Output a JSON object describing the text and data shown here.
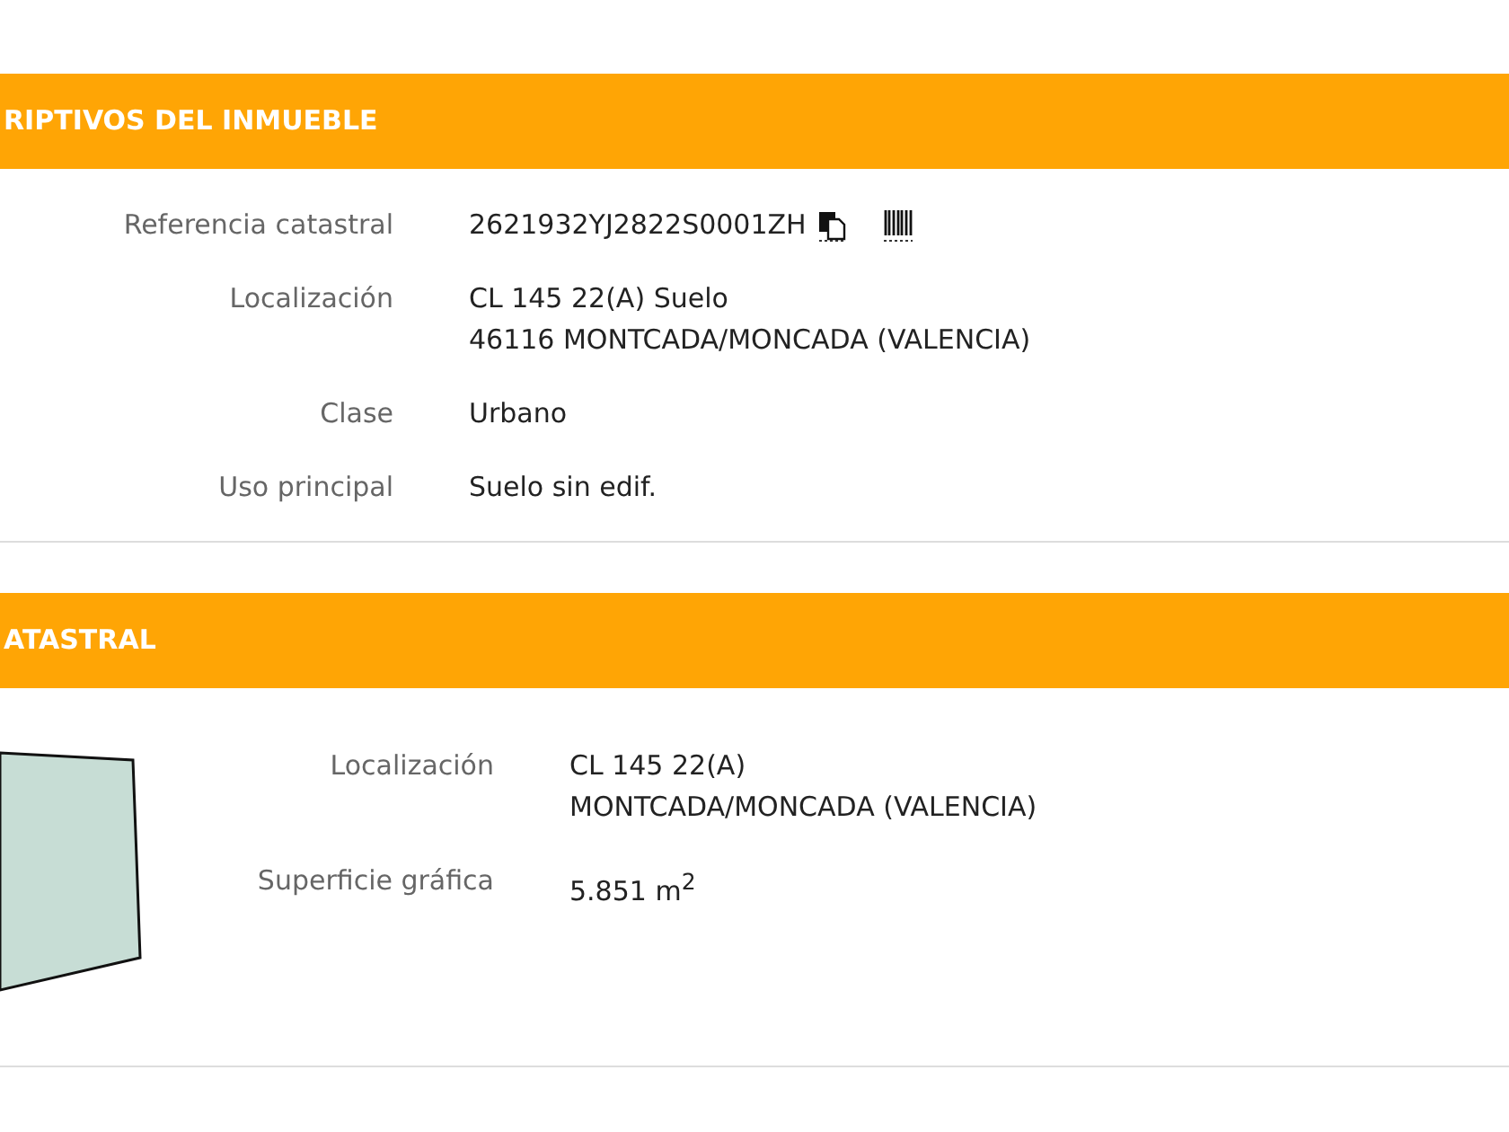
{
  "sections": [
    {
      "title": "RIPTIVOS DEL INMUEBLE",
      "rows": [
        {
          "label": "Referencia catastral",
          "lines": [
            "2621932YJ2822S0001ZH"
          ],
          "icons": true
        },
        {
          "label": "Localización",
          "lines": [
            "CL 145 22(A) Suelo",
            "46116 MONTCADA/MONCADA (VALENCIA)"
          ]
        },
        {
          "label": "Clase",
          "lines": [
            "Urbano"
          ]
        },
        {
          "label": "Uso principal",
          "lines": [
            "Suelo sin edif."
          ]
        }
      ]
    },
    {
      "title": "ATASTRAL",
      "parcel": true,
      "rows": [
        {
          "label": "Localización",
          "lines": [
            "CL 145 22(A)",
            "MONTCADA/MONCADA (VALENCIA)"
          ]
        },
        {
          "label": "Superficie gráfica",
          "lines": [
            "5.851 m$^{2}$"
          ]
        }
      ]
    }
  ]
}
